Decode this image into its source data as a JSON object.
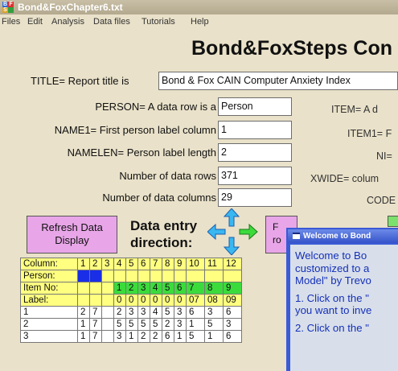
{
  "window": {
    "title": "Bond&FoxChapter6.txt",
    "icon": "bond-fox-app-icon"
  },
  "menu": [
    "Files",
    "Edit",
    "Analysis",
    "Data files",
    "Tutorials",
    "Help"
  ],
  "heading": "Bond&FoxSteps Con",
  "title_row": {
    "label": "TITLE= Report title is",
    "value": "Bond & Fox CAIN Computer Anxiety Index"
  },
  "left_fields": [
    {
      "label": "PERSON= A data row is a",
      "value": "Person"
    },
    {
      "label": "NAME1= First person label column",
      "value": "1"
    },
    {
      "label": "NAMELEN= Person label length",
      "value": "2"
    },
    {
      "label": "Number of data rows",
      "value": "371"
    },
    {
      "label": "Number of data columns",
      "value": "29"
    }
  ],
  "right_labels": [
    "ITEM= A d",
    "ITEM1= F",
    "NI=",
    "XWIDE= colum",
    "CODE"
  ],
  "buttons": {
    "refresh": [
      "Refresh Data",
      "Display"
    ],
    "direction": [
      "Data entry",
      "direction:"
    ],
    "second": [
      "F",
      "ro"
    ]
  },
  "colors": {
    "accent_pink": "#E8A6E8",
    "grid_yellow": "#FFFF80",
    "grid_green": "#3CDB3C",
    "grid_blue": "#1A2EE8",
    "dialog_blue": "#3A5AD6",
    "dialog_text": "#1530B8"
  },
  "grid": {
    "row_labels": [
      "Column:",
      "Person:",
      "Item No:",
      "Label:",
      "1",
      "2",
      "3"
    ],
    "column_numbers": [
      "1",
      "2",
      "3",
      "4",
      "5",
      "6",
      "7",
      "8",
      "9",
      "10",
      "11",
      "12"
    ],
    "item_numbers": [
      "1",
      "2",
      "3",
      "4",
      "5",
      "6",
      "7",
      "8",
      "9"
    ],
    "item_labels": [
      "0",
      "0",
      "0",
      "0",
      "0",
      "0",
      "07",
      "08",
      "09"
    ],
    "data_rows": [
      [
        "2",
        "7",
        "",
        "2",
        "3",
        "3",
        "4",
        "5",
        "3",
        "6",
        "3",
        "6"
      ],
      [
        "1",
        "7",
        "",
        "5",
        "5",
        "5",
        "5",
        "2",
        "3",
        "1",
        "5",
        "3"
      ],
      [
        "1",
        "7",
        "",
        "3",
        "1",
        "2",
        "2",
        "6",
        "1",
        "5",
        "1",
        "6"
      ]
    ]
  },
  "dialog": {
    "title": "Welcome to Bond",
    "paragraphs": [
      [
        "Welcome to Bo",
        "customized to a",
        "Model\" by Trevo"
      ],
      [
        "1. Click on the \"",
        "you want to inve"
      ],
      [
        "2. Click on the \""
      ]
    ]
  }
}
